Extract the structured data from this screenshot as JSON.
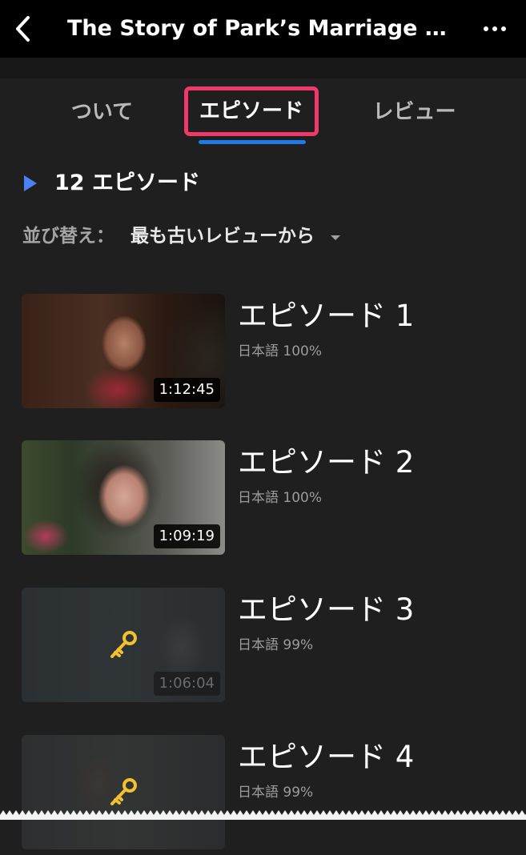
{
  "header": {
    "title": "The Story of Park’s Marriage C...",
    "back_icon": "chevron-left-icon",
    "more_icon": "more-horizontal-icon"
  },
  "tabs": [
    {
      "label": "ついて",
      "selected": false
    },
    {
      "label": "エピソード",
      "selected": true
    },
    {
      "label": "レビュー",
      "selected": false
    }
  ],
  "episodes_header": {
    "count_label": "12 エピソード"
  },
  "sort": {
    "label": "並び替え：",
    "value": "最も古いレビューから"
  },
  "episodes": [
    {
      "title": "エピソード 1",
      "language": "日本語 100%",
      "duration": "1:12:45",
      "locked": false
    },
    {
      "title": "エピソード 2",
      "language": "日本語 100%",
      "duration": "1:09:19",
      "locked": false
    },
    {
      "title": "エピソード 3",
      "language": "日本語 99%",
      "duration": "1:06:04",
      "locked": true
    },
    {
      "title": "エピソード 4",
      "language": "日本語 99%",
      "duration": "",
      "locked": true
    }
  ],
  "colors": {
    "background": "#1f1f1f",
    "topbar": "#000000",
    "tab_highlight_border": "#f0386b",
    "tab_underline": "#1e7ae6",
    "play_icon": "#4a82f5",
    "key_icon": "#f2c12e"
  }
}
